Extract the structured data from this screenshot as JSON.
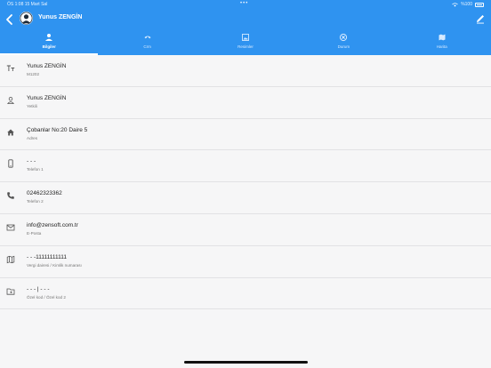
{
  "status_bar": {
    "time_date": "ÖS 1:08   15 Mart Sal",
    "dots": "•••",
    "battery_text": "%100"
  },
  "header": {
    "title": "Yunus ZENGİN"
  },
  "tabs": [
    {
      "label": "Bilgiler",
      "icon": "person-icon",
      "active": true
    },
    {
      "label": "Crm",
      "icon": "phone-icon",
      "active": false
    },
    {
      "label": "Resimler",
      "icon": "image-icon",
      "active": false
    },
    {
      "label": "Durum",
      "icon": "status-icon",
      "active": false
    },
    {
      "label": "Harita",
      "icon": "map-icon",
      "active": false
    }
  ],
  "fields": [
    {
      "value": "Yunus ZENGİN",
      "label": "M1202",
      "icon": "text-format-icon"
    },
    {
      "value": "Yunus ZENGİN",
      "label": "Yetkili",
      "icon": "person-icon"
    },
    {
      "value": "Çobanlar No:20 Daire 5",
      "label": "Adres",
      "icon": "home-icon"
    },
    {
      "value": "- - -",
      "label": "Telefon 1",
      "icon": "mobile-phone-icon"
    },
    {
      "value": "02462323362",
      "label": "Telefon 2",
      "icon": "phone-icon"
    },
    {
      "value": "info@zensoft.com.tr",
      "label": "E-Posta",
      "icon": "mail-icon"
    },
    {
      "value": "- - -11111111111",
      "label": "Vergi dairesi / Kimlik numarası",
      "icon": "map-icon"
    },
    {
      "value": "- - - | - - -",
      "label": "Özel kod / Özel kod 2",
      "icon": "folder-icon"
    }
  ],
  "colors": {
    "primary": "#2f93f0",
    "background": "#f6f6f7"
  }
}
